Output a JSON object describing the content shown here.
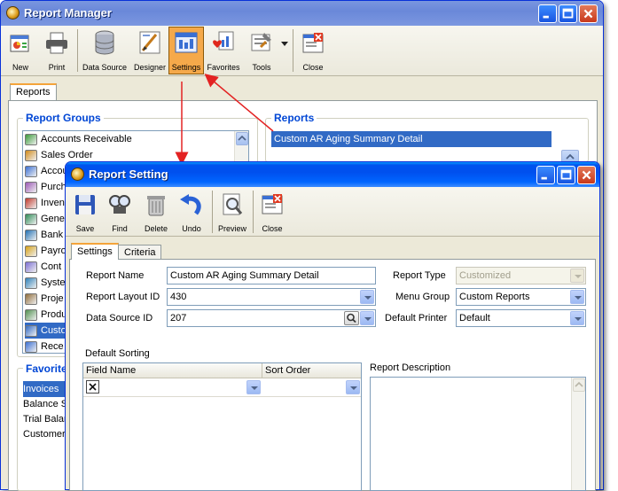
{
  "main_window": {
    "title": "Report Manager",
    "toolbar": [
      {
        "label": "New",
        "icon": "new-report-icon"
      },
      {
        "label": "Print",
        "icon": "printer-icon"
      },
      {
        "label": "Data Source",
        "icon": "database-icon"
      },
      {
        "label": "Designer",
        "icon": "designer-icon"
      },
      {
        "label": "Settings",
        "icon": "settings-icon",
        "active": true
      },
      {
        "label": "Favorites",
        "icon": "favorites-icon"
      },
      {
        "label": "Tools",
        "icon": "tools-icon"
      },
      {
        "label": "Close",
        "icon": "close-report-icon"
      }
    ],
    "tab": "Reports",
    "report_groups_title": "Report Groups",
    "report_groups": [
      "Accounts Receivable",
      "Sales Order",
      "Accou",
      "Purch",
      "Inven",
      "Gene",
      "Bank",
      "Payro",
      "Cont",
      "Syste",
      "Proje",
      "Produ",
      "Custo",
      "Rece"
    ],
    "reports_title": "Reports",
    "reports": [
      "Custom AR Aging Summary Detail"
    ],
    "favorites_title": "Favorite",
    "favorites": [
      "Invoices",
      "Balance S",
      "Trial Balan",
      "Customer"
    ]
  },
  "setting_window": {
    "title": "Report Setting",
    "toolbar": [
      {
        "label": "Save",
        "icon": "save-icon"
      },
      {
        "label": "Find",
        "icon": "find-icon"
      },
      {
        "label": "Delete",
        "icon": "trash-icon"
      },
      {
        "label": "Undo",
        "icon": "undo-icon"
      },
      {
        "label": "Preview",
        "icon": "preview-icon"
      },
      {
        "label": "Close",
        "icon": "close-window-icon"
      }
    ],
    "tabs": [
      "Settings",
      "Criteria"
    ],
    "form": {
      "report_name_label": "Report Name",
      "report_name": "Custom AR Aging Summary Detail",
      "layout_id_label": "Report Layout ID",
      "layout_id": "430",
      "data_source_label": "Data Source ID",
      "data_source": "207",
      "report_type_label": "Report Type",
      "report_type": "Customized",
      "menu_group_label": "Menu Group",
      "menu_group": "Custom Reports",
      "default_printer_label": "Default Printer",
      "default_printer": "Default",
      "default_sorting_label": "Default Sorting",
      "field_name_header": "Field Name",
      "sort_order_header": "Sort Order",
      "report_description_label": "Report Description"
    }
  },
  "colors": {
    "title_blue": "#0054e3",
    "selection": "#316ac5",
    "group_title": "#0046d5",
    "active_button": "#f5a94a",
    "arrow": "#e32222"
  }
}
